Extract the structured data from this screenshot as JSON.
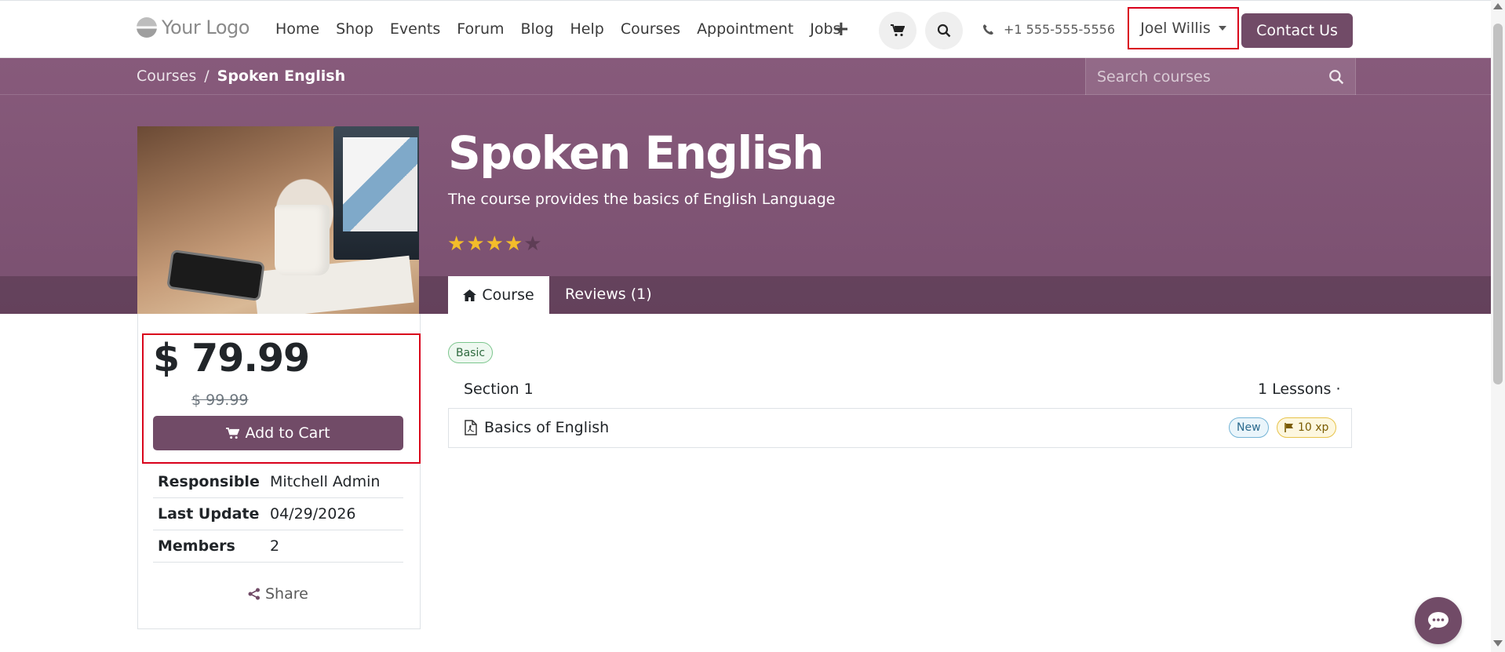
{
  "header": {
    "logo_text": "Your Logo",
    "nav": [
      "Home",
      "Shop",
      "Events",
      "Forum",
      "Blog",
      "Help",
      "Courses",
      "Appointment",
      "Jobs"
    ],
    "phone": "+1 555-555-5556",
    "user": "Joel Willis",
    "contact_label": "Contact Us"
  },
  "breadcrumb": {
    "root": "Courses",
    "separator": "/",
    "current": "Spoken English"
  },
  "search": {
    "placeholder": "Search courses"
  },
  "course": {
    "title": "Spoken English",
    "description": "The course provides the basics of English Language",
    "rating_stars": 4,
    "rating_max": 5,
    "tabs": {
      "course": "Course",
      "reviews": "Reviews (1)"
    }
  },
  "pricing": {
    "price": "$ 79.99",
    "old_price": "$ 99.99",
    "add_to_cart": "Add to Cart"
  },
  "info": [
    {
      "key": "Responsible",
      "value": "Mitchell Admin"
    },
    {
      "key": "Last Update",
      "value": "04/29/2026"
    },
    {
      "key": "Members",
      "value": "2"
    }
  ],
  "share_label": "Share",
  "content": {
    "tag": "Basic",
    "section": {
      "name": "Section 1",
      "count": "1 Lessons ·"
    },
    "lesson": {
      "name": "Basics of English",
      "new_badge": "New",
      "xp_badge": "10 xp"
    }
  },
  "colors": {
    "brand": "#714b67",
    "hero": "#875a7b",
    "highlight": "#d9001b",
    "star": "#f3bd2a"
  }
}
